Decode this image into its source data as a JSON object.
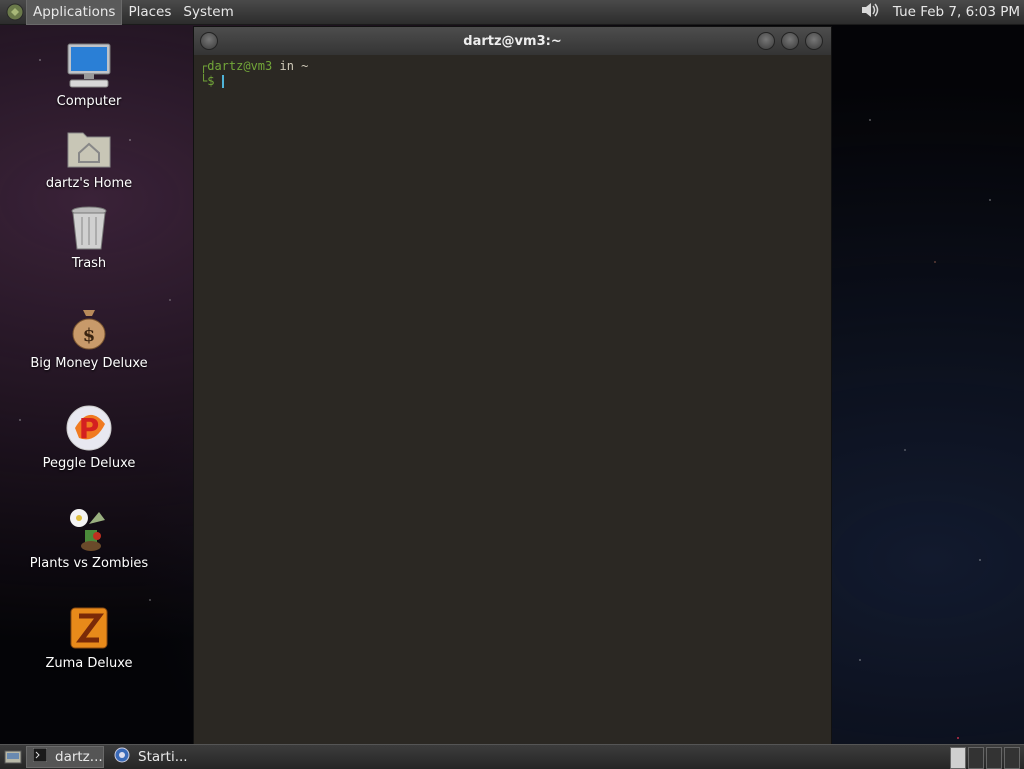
{
  "top_panel": {
    "menus": [
      "Applications",
      "Places",
      "System"
    ],
    "clock": "Tue Feb  7,  6:03 PM",
    "tray_icon": "volume-icon"
  },
  "desktop_icons": [
    {
      "label": "Computer",
      "icon": "computer-icon"
    },
    {
      "label": "dartz's Home",
      "icon": "home-folder-icon"
    },
    {
      "label": "Trash",
      "icon": "trash-icon"
    },
    {
      "label": "Big Money Deluxe",
      "icon": "money-bag-icon"
    },
    {
      "label": "Peggle Deluxe",
      "icon": "peggle-icon"
    },
    {
      "label": "Plants vs Zombies",
      "icon": "plants-icon"
    },
    {
      "label": "Zuma Deluxe",
      "icon": "zuma-icon"
    }
  ],
  "terminal": {
    "title": "dartz@vm3:~",
    "prompt_user": "dartz@vm3",
    "prompt_in": " in ~",
    "prompt_symbol": "$"
  },
  "taskbar": {
    "tasks": [
      {
        "label": "dartz...",
        "icon": "terminal-icon"
      },
      {
        "label": "Starti...",
        "icon": "browser-icon"
      }
    ]
  },
  "colors": {
    "terminal_bg": "#2b2823",
    "prompt_green": "#72a639",
    "cursor": "#4fb4d8"
  }
}
